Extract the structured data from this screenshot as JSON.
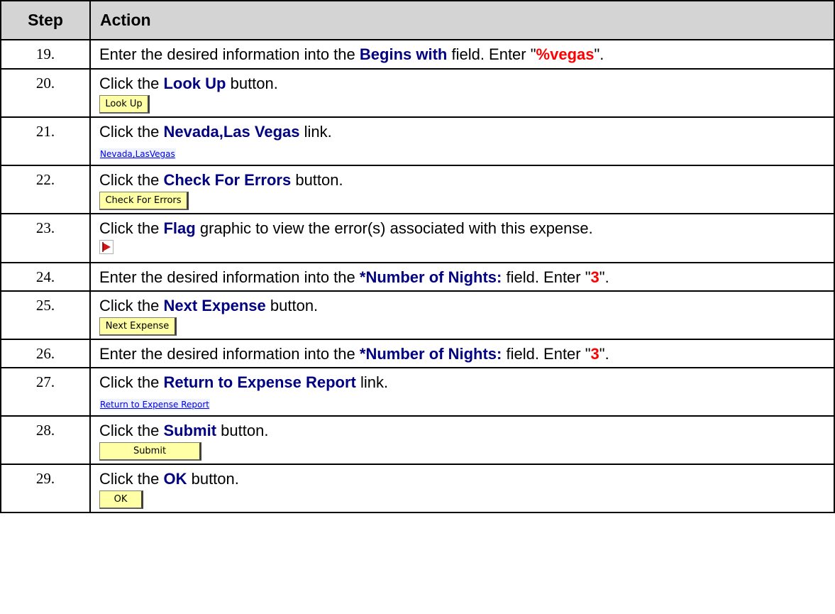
{
  "header": {
    "step": "Step",
    "action": "Action"
  },
  "rows": [
    {
      "num": "19.",
      "t1": "Enter the desired information into the ",
      "kw": "Begins with",
      "t2": " field. Enter \"",
      "val": "%vegas",
      "t3": "\"."
    },
    {
      "num": "20.",
      "t1": "Click the ",
      "kw": "Look Up",
      "t2": " button.",
      "control": "Look Up"
    },
    {
      "num": "21.",
      "t1": "Click the ",
      "kw": "Nevada,Las Vegas",
      "t2": " link.",
      "control": "Nevada,LasVegas"
    },
    {
      "num": "22.",
      "t1": "Click the ",
      "kw": "Check For Errors",
      "t2": " button.",
      "control": "Check For Errors"
    },
    {
      "num": "23.",
      "t1": "Click the ",
      "kw": "Flag",
      "t2": " graphic to view the error(s) associated with this expense.",
      "icon": "red-flag-icon"
    },
    {
      "num": "24.",
      "t1": "Enter the desired information into the ",
      "kw": "*Number of Nights:",
      "t2": " field. Enter \"",
      "val": "3",
      "t3": "\"."
    },
    {
      "num": "25.",
      "t1": "Click the ",
      "kw": "Next Expense",
      "t2": " button.",
      "control": "Next Expense"
    },
    {
      "num": "26.",
      "t1": "Enter the desired information into the ",
      "kw": "*Number of Nights:",
      "t2": " field. Enter \"",
      "val": "3",
      "t3": "\"."
    },
    {
      "num": "27.",
      "t1": "Click the ",
      "kw": "Return to Expense Report",
      "t2": " link.",
      "control": "Return to Expense Report"
    },
    {
      "num": "28.",
      "t1": "Click the ",
      "kw": "Submit",
      "t2": " button.",
      "control": "Submit"
    },
    {
      "num": "29.",
      "t1": "Click the ",
      "kw": "OK",
      "t2": " button.",
      "control": "OK"
    }
  ],
  "colors": {
    "keyword": "#000080",
    "value": "#ff0000",
    "button_bg": "#ffffa5",
    "header_bg": "#d4d4d4",
    "link": "#0000ee"
  }
}
